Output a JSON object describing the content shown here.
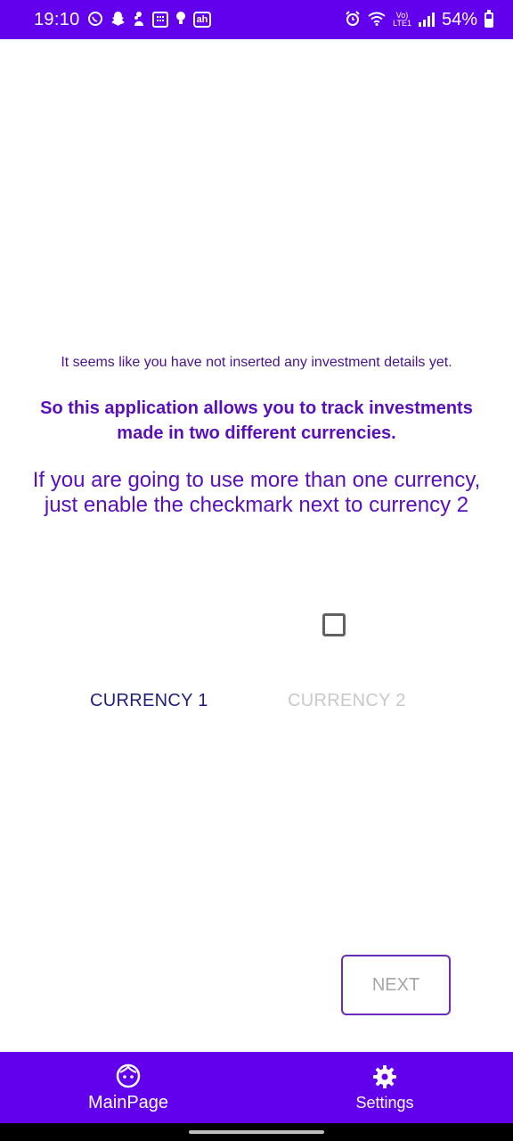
{
  "status_bar": {
    "time": "19:10",
    "battery": "54%",
    "icons_left": [
      "whatsapp-icon",
      "snapchat-icon",
      "app-icon",
      "keyboard-icon",
      "bulb-icon",
      "ah-icon"
    ],
    "icons_right": [
      "alarm-icon",
      "wifi-icon",
      "volte-icon",
      "signal-icon",
      "battery-icon"
    ],
    "ah_label": "ah",
    "volte_label": "Vo)",
    "lte_label": "LTE1"
  },
  "messages": {
    "line1": "It seems like you have not inserted any investment details yet.",
    "line2": "So this application allows you to track investments made in two different currencies.",
    "line3": "If you are going to use more than one currency, just enable the checkmark next to currency 2"
  },
  "currency": {
    "label1": "CURRENCY 1",
    "label2": "CURRENCY 2",
    "currency2_enabled": false
  },
  "next_button": {
    "label": "NEXT"
  },
  "bottom_nav": {
    "items": [
      {
        "label": "MainPage",
        "icon": "face-icon"
      },
      {
        "label": "Settings",
        "icon": "gear-icon"
      }
    ]
  },
  "colors": {
    "primary": "#6200ee",
    "text_purple": "#5a0fbf",
    "currency1": "#1f1f7a",
    "disabled": "#c9c9c9"
  }
}
